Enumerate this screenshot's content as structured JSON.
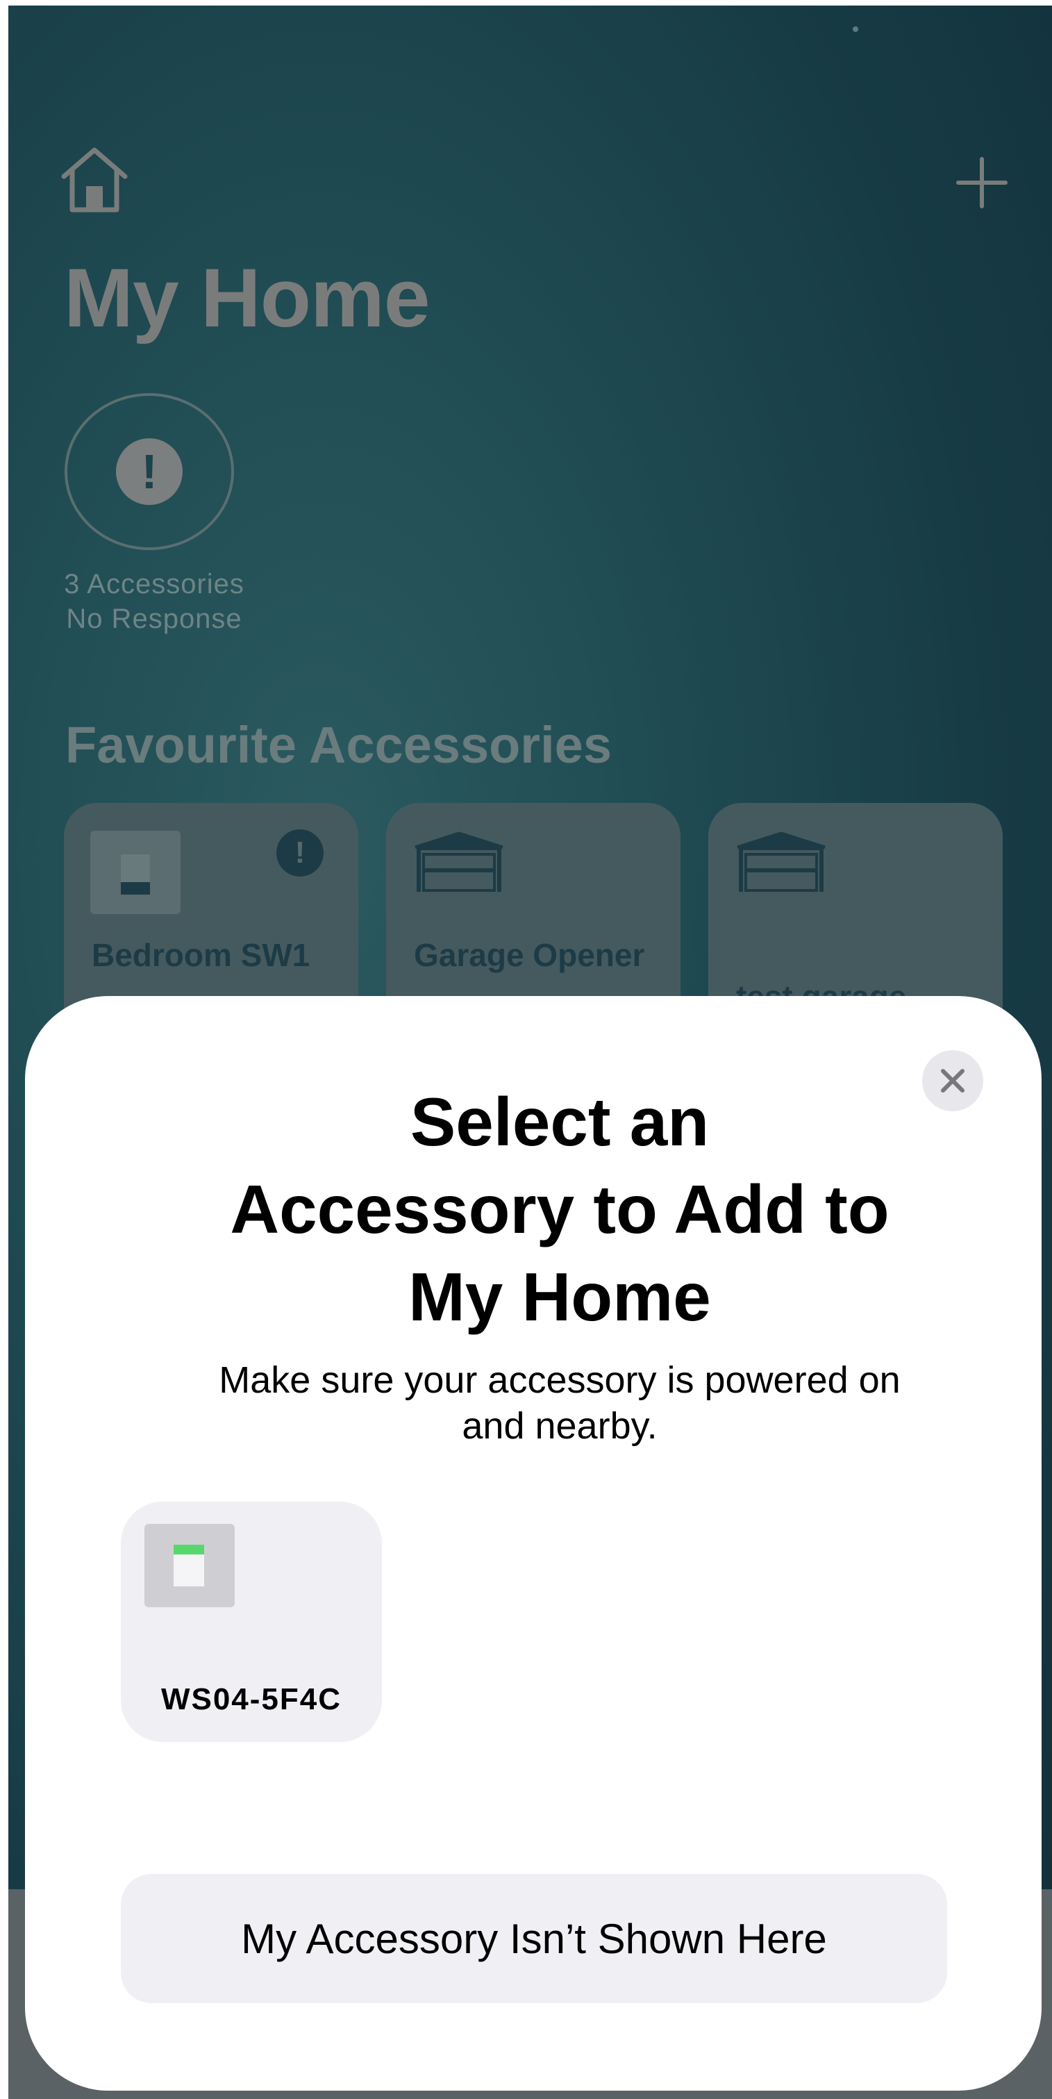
{
  "background_screen": {
    "title": "My Home",
    "status": {
      "line1": "3 Accessories",
      "line2": "No Response"
    },
    "section_title": "Favourite Accessories",
    "favourites": [
      {
        "name": "Bedroom SW1",
        "icon": "switch-icon",
        "alert": "!"
      },
      {
        "name": "Garage Opener",
        "icon": "garage-door-icon"
      },
      {
        "name": "test garage",
        "icon": "garage-door-icon"
      }
    ]
  },
  "sheet": {
    "title_lines": [
      "Select an",
      "Accessory to Add to",
      "My Home"
    ],
    "subtitle_lines": [
      "Make sure your accessory is powered on",
      "and nearby."
    ],
    "accessories": [
      {
        "label": "WS04-5F4C",
        "icon": "switch-icon"
      }
    ],
    "not_shown_label": "My Accessory Isn’t Shown Here"
  },
  "colors": {
    "background": "#1f4a52",
    "sheet": "#ffffff",
    "card": "#f0f0f4",
    "switch_led": "#56d86a"
  }
}
